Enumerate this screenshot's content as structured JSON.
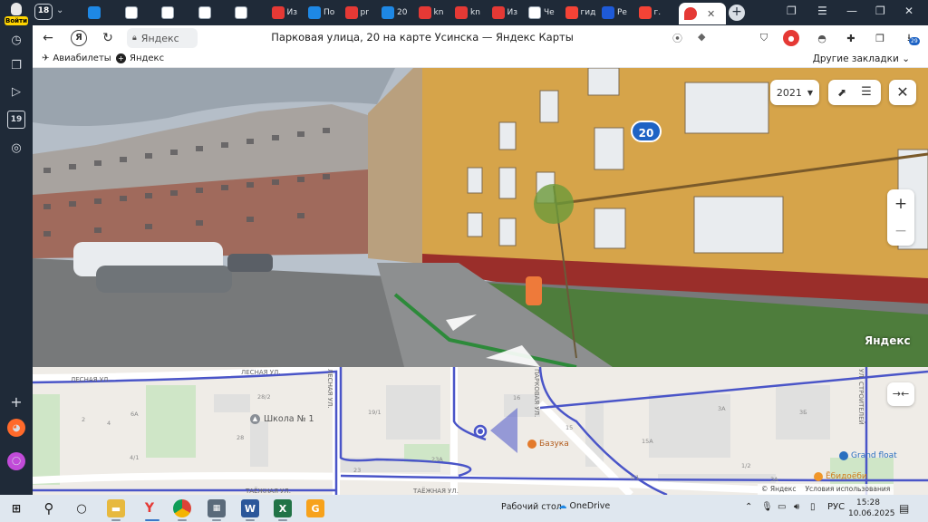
{
  "browser": {
    "tab_count": "18",
    "login_label": "Войти",
    "tabs": [
      {
        "favicon": "cloud-icon",
        "color": "#1e88e5",
        "label": ""
      },
      {
        "favicon": "document-icon",
        "color": "#ffffff",
        "label": ""
      },
      {
        "favicon": "image-icon",
        "color": "#ffffff",
        "label": ""
      },
      {
        "favicon": "image-icon",
        "color": "#ffffff",
        "label": ""
      },
      {
        "favicon": "image-icon",
        "color": "#ffffff",
        "label": ""
      },
      {
        "favicon": "pdf-icon",
        "color": "#e53935",
        "label": "Из"
      },
      {
        "favicon": "mail-icon",
        "color": "#1e88e5",
        "label": "По"
      },
      {
        "favicon": "pdf-icon",
        "color": "#e53935",
        "label": "pr"
      },
      {
        "favicon": "mail-icon",
        "color": "#1e88e5",
        "label": "20"
      },
      {
        "favicon": "pdf-icon",
        "color": "#e53935",
        "label": "kn"
      },
      {
        "favicon": "pdf-icon",
        "color": "#e53935",
        "label": "kn"
      },
      {
        "favicon": "rtf-icon",
        "color": "#e53935",
        "label": "Из"
      },
      {
        "favicon": "document-icon",
        "color": "#ffffff",
        "label": "Че"
      },
      {
        "favicon": "yandex-icon",
        "color": "#f44336",
        "label": "гид"
      },
      {
        "favicon": "shield-icon",
        "color": "#1e5ad8",
        "label": "Ре"
      },
      {
        "favicon": "yandex-icon",
        "color": "#f44336",
        "label": "г."
      }
    ],
    "active_tab": {
      "favicon": "map-pin-icon",
      "color": "#e53935"
    },
    "address": {
      "domain": "Яндекс",
      "title": "Парковая улица, 20 на карте Усинска — Яндекс Карты"
    },
    "bookmarks": [
      {
        "icon": "plane-icon",
        "label": "Авиабилеты"
      },
      {
        "icon": "yandex-icon",
        "label": "Яндекс"
      }
    ],
    "other_bookmarks": "Другие закладки",
    "downloads_badge": "29"
  },
  "panorama": {
    "year": "2021",
    "house_number": "20",
    "watermark": "Яндекс"
  },
  "map": {
    "streets": [
      "ЛЕСНАЯ УЛ.",
      "ЛЕСНАЯ УЛ.",
      "ЛЕСНАЯ УЛ.",
      "ПАРКОВАЯ УЛ.",
      "ТАЁЖНАЯ УЛ.",
      "ТАЁЖНАЯ УЛ.",
      "УЛ. СТРОИТЕЛЕЙ"
    ],
    "house_numbers": [
      "28/2",
      "19/1",
      "16",
      "6А",
      "2",
      "4",
      "28",
      "15",
      "15А",
      "3А",
      "4/1",
      "23",
      "23А",
      "1/1",
      "1/2",
      "3А",
      "3Б"
    ],
    "pois": {
      "school": "Школа № 1",
      "cafe": "Базука",
      "fitness": "Grand float",
      "shop": "Ёбидоёби"
    },
    "copyright": "© Яндекс",
    "terms": "Условия использования"
  },
  "taskbar": {
    "desktop_label": "Рабочий стол",
    "onedrive_label": "OneDrive",
    "language": "РУС",
    "time": "15:28",
    "date": "10.06.2025"
  },
  "colors": {
    "sidebar_bg": "#1f2a38",
    "facade_yellow": "#d6a44a",
    "plinth_red": "#9a2e2a",
    "map_route": "#4a55c8",
    "brand_blue": "#1e63c4"
  }
}
